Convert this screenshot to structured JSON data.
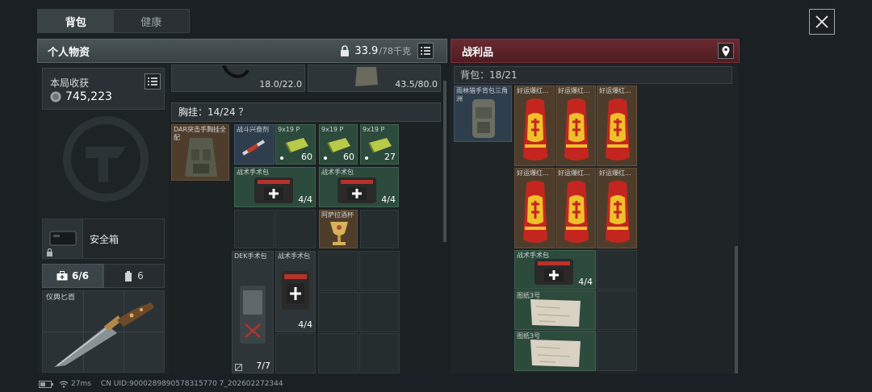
{
  "tabs": [
    {
      "label": "背包"
    },
    {
      "label": "健康"
    }
  ],
  "left_header": {
    "title": "个人物资",
    "weight": "33.9",
    "weight_max": "/78千克"
  },
  "round_income": {
    "label": "本局收获",
    "value": "745,223"
  },
  "safe_box": {
    "label": "安全箱"
  },
  "mini_tabs": [
    {
      "label": "6/6"
    },
    {
      "label": "6"
    }
  ],
  "knife": {
    "label": "仪典匕首"
  },
  "top_weights": [
    "18.0/22.0",
    "43.5/80.0"
  ],
  "chest_rig": {
    "label": "胸挂：14/24 ？",
    "item_name": "DAR突击手胸挂全配"
  },
  "rig_items": [
    {
      "name": "战斗兴奋剂"
    },
    {
      "name": "9x19 P",
      "count": "60"
    },
    {
      "name": "9x19 P",
      "count": "60"
    },
    {
      "name": "9x19 P",
      "count": "27"
    },
    {
      "name": "战术手术包",
      "count": "4/4"
    },
    {
      "name": "战术手术包",
      "count": "4/4"
    },
    {
      "name": "阿萨拉酒杯"
    }
  ],
  "bag_items": [
    {
      "name": "DEK手术包",
      "count": "7/7"
    },
    {
      "name": "战术手术包",
      "count": "4/4"
    }
  ],
  "loot_header": {
    "title": "战利品"
  },
  "loot_backpack": {
    "label": "背包：18/21",
    "item_name": "雨林猎手背包三角洲"
  },
  "loot_items": [
    {
      "name": "好运爆红..."
    },
    {
      "name": "好运爆红..."
    },
    {
      "name": "好运爆红..."
    },
    {
      "name": "好运爆红..."
    },
    {
      "name": "好运爆红..."
    },
    {
      "name": "好运爆红..."
    },
    {
      "name": "战术手术包",
      "count": "4/4"
    },
    {
      "name": "图纸3号"
    },
    {
      "name": "图纸3号"
    }
  ],
  "footer": {
    "ping": "27ms",
    "uid": "CN UID:9000289890578315770 7_202602272344"
  },
  "colors": {
    "loot_header": "#5a2228",
    "panel_header": "#414b4e",
    "gold_item": "#4f3d2c",
    "green_item": "#2d4b3c"
  }
}
